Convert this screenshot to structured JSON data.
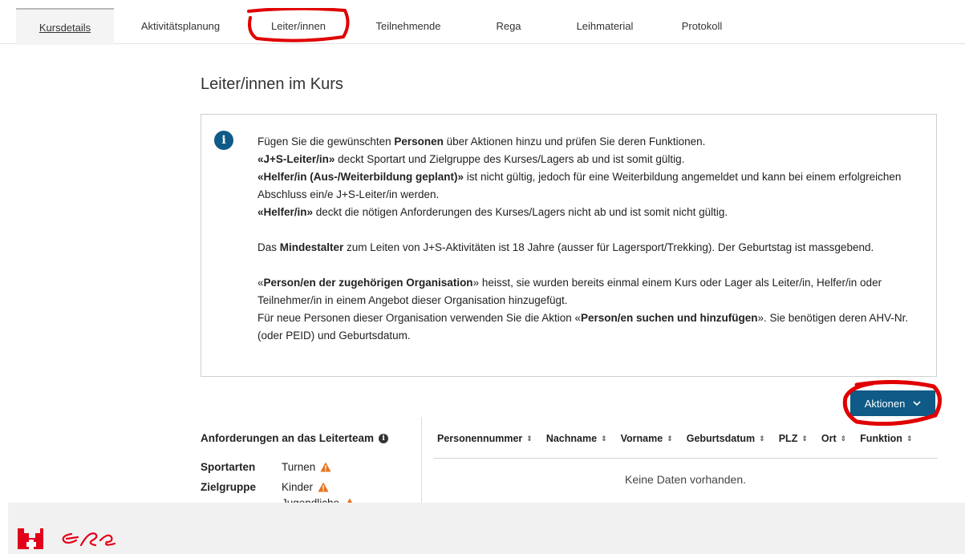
{
  "tabs": [
    {
      "label": "Kursdetails",
      "active": true
    },
    {
      "label": "Aktivitätsplanung",
      "active": false
    },
    {
      "label": "Leiter/innen",
      "active": false
    },
    {
      "label": "Teilnehmende",
      "active": false
    },
    {
      "label": "Rega",
      "active": false
    },
    {
      "label": "Leihmaterial",
      "active": false
    },
    {
      "label": "Protokoll",
      "active": false
    }
  ],
  "page_title": "Leiter/innen im Kurs",
  "info": {
    "p1_a": "Fügen Sie die gewünschten ",
    "p1_b": "Personen",
    "p1_c": " über Aktionen hinzu und prüfen Sie deren Funktionen.",
    "p2_a": "«J+S-Leiter/in»",
    "p2_b": " deckt Sportart und Zielgruppe des Kurses/Lagers ab und ist somit gültig.",
    "p3_a": "«Helfer/in (Aus-/Weiterbildung geplant)»",
    "p3_b": " ist nicht gültig, jedoch für eine Weiterbildung angemeldet und kann bei einem erfolgreichen Abschluss ein/e J+S-Leiter/in werden.",
    "p4_a": "«Helfer/in»",
    "p4_b": " deckt die nötigen Anforderungen des Kurses/Lagers nicht ab und ist somit nicht gültig.",
    "p5_a": "Das ",
    "p5_b": "Mindestalter",
    "p5_c": " zum Leiten von J+S-Aktivitäten ist 18 Jahre (ausser für Lagersport/Trekking). Der Geburtstag ist massgebend.",
    "p6_a": "«",
    "p6_b": "Person/en der zugehörigen Organisation",
    "p6_c": "» heisst, sie wurden bereits einmal einem Kurs oder Lager als Leiter/in, Helfer/in oder Teilnehmer/in in einem Angebot dieser Organisation hinzugefügt.",
    "p7_a": "Für neue Personen dieser Organisation verwenden Sie die Aktion «",
    "p7_b": "Person/en suchen und hinzufügen",
    "p7_c": "». Sie benötigen deren AHV-Nr. (oder PEID) und Geburtsdatum."
  },
  "actions_button": {
    "label": "Aktionen"
  },
  "requirements": {
    "title": "Anforderungen an das Leiterteam",
    "sport_label": "Sportarten",
    "sport_value": "Turnen",
    "target_label": "Zielgruppe",
    "target_values": [
      "Kinder",
      "Jugendliche"
    ]
  },
  "table": {
    "columns": [
      "Personennummer",
      "Nachname",
      "Vorname",
      "Geburtsdatum",
      "PLZ",
      "Ort",
      "Funktion"
    ],
    "sort_glyph": "⇕",
    "empty_message": "Keine Daten vorhanden."
  },
  "colors": {
    "primary": "#0f5a87",
    "warning": "#e8731e",
    "annotation": "#e00000"
  }
}
